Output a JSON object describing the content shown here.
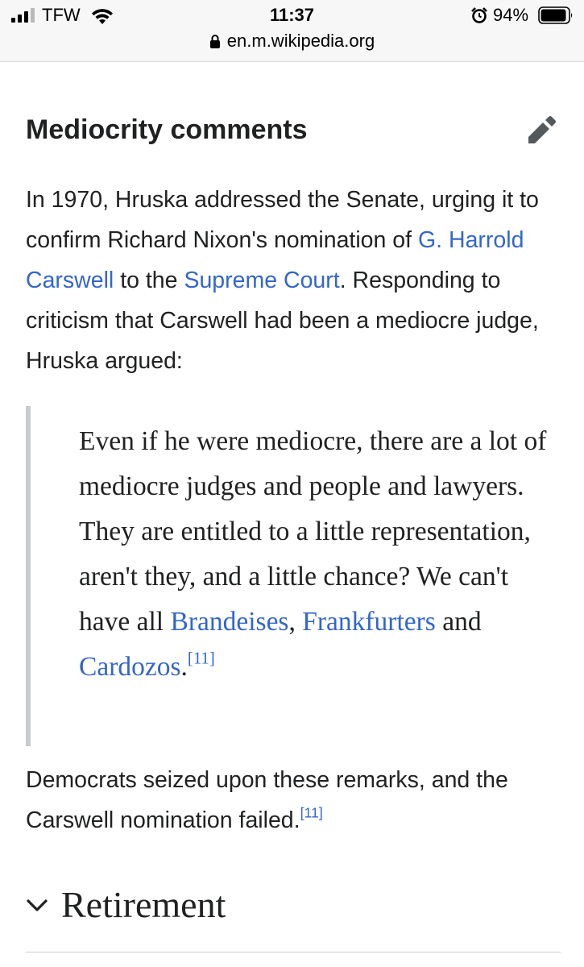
{
  "status_bar": {
    "carrier": "TFW",
    "time": "11:37",
    "battery_percent": "94%",
    "battery_level": 0.94
  },
  "browser": {
    "url": "en.m.wikipedia.org"
  },
  "section": {
    "heading": "Mediocrity comments",
    "edit_icon": "pencil-icon",
    "intro": {
      "t1": "In 1970, Hruska addressed the Senate, urging it to confirm Richard Nixon's nomination of ",
      "link_carswell": "G. Harrold Carswell",
      "t2": " to the ",
      "link_court": "Supreme Court",
      "t3": ". Responding to criticism that Carswell had been a mediocre judge, Hruska argued:"
    },
    "quote": {
      "t1": "Even if he were mediocre, there are a lot of mediocre judges and people and lawyers. They are entitled to a little representation, aren't they, and a little chance? We can't have all ",
      "link_brandeises": "Brandeises",
      "t2": ", ",
      "link_frankfurters": "Frankfurters",
      "t3": " and ",
      "link_cardozos": "Cardozos",
      "t4": ".",
      "ref": "[11]"
    },
    "outro": {
      "t1": "Democrats seized upon these remarks, and the Carswell nomination failed.",
      "ref": "[11]"
    }
  },
  "next_section": {
    "title": "Retirement",
    "chevron_icon": "chevron-down-icon"
  },
  "colors": {
    "link": "#3366cc",
    "text": "#202122",
    "quote_bar": "#c8ccd1"
  }
}
